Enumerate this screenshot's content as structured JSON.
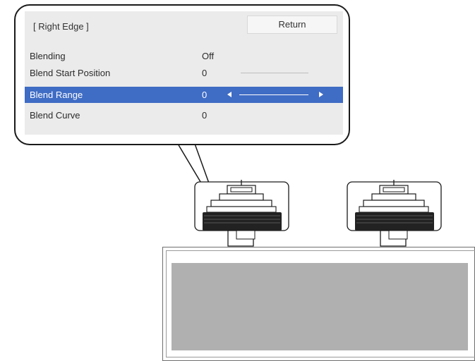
{
  "menu": {
    "title": "[ Right Edge ]",
    "return_label": "Return",
    "rows": [
      {
        "label": "Blending",
        "value": "Off"
      },
      {
        "label": "Blend Start Position",
        "value": "0"
      },
      {
        "label": "Blend Range",
        "value": "0"
      },
      {
        "label": "Blend Curve",
        "value": "0"
      }
    ],
    "selected_row": "Blend Range",
    "selection_color": "#3f6cc4"
  }
}
